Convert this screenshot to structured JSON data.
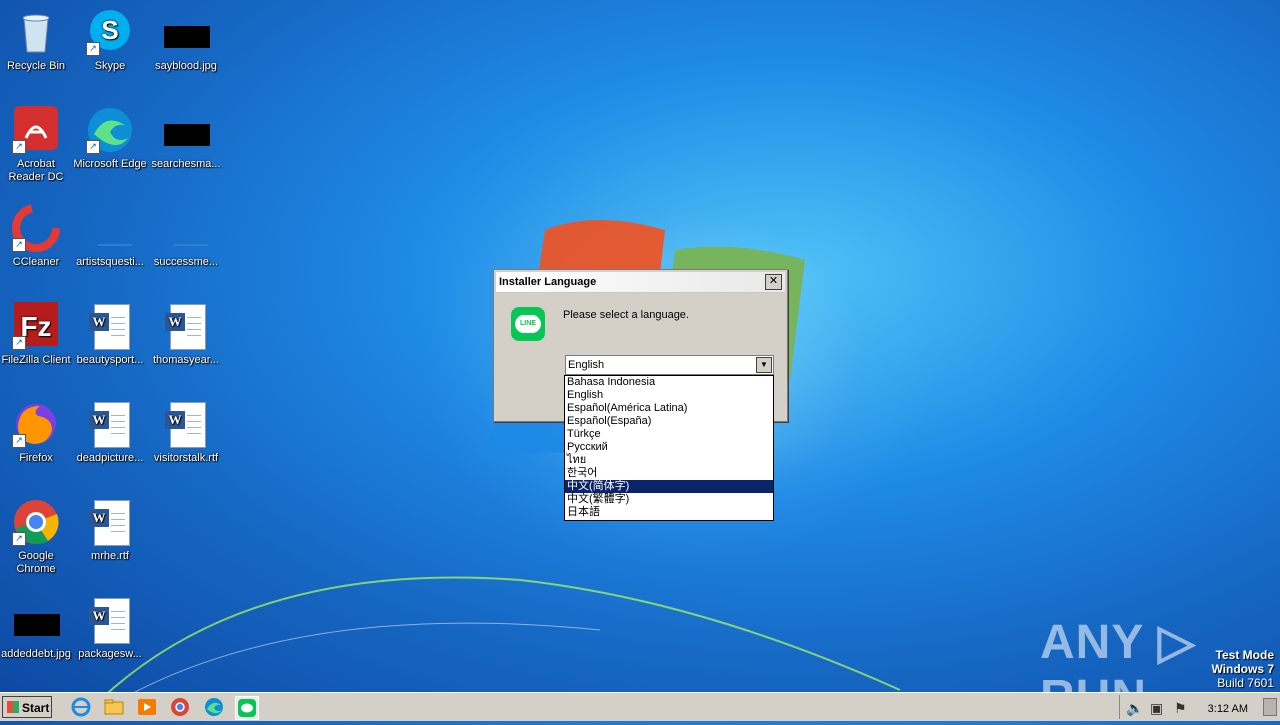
{
  "desktop": {
    "icons": [
      {
        "label": "Recycle Bin"
      },
      {
        "label": "Skype"
      },
      {
        "label": "sayblood.jpg"
      },
      {
        "label": "Acrobat Reader DC"
      },
      {
        "label": "Microsoft Edge"
      },
      {
        "label": "searchesma..."
      },
      {
        "label": "CCleaner"
      },
      {
        "label": "artistsquesti..."
      },
      {
        "label": "successme..."
      },
      {
        "label": "FileZilla Client"
      },
      {
        "label": "beautysport..."
      },
      {
        "label": "thomasyear..."
      },
      {
        "label": "Firefox"
      },
      {
        "label": "deadpicture..."
      },
      {
        "label": "visitorstalk.rtf"
      },
      {
        "label": "Google Chrome"
      },
      {
        "label": "mrhe.rtf"
      },
      {
        "label": "addeddebt.jpg"
      },
      {
        "label": "packagesw..."
      }
    ]
  },
  "dialog": {
    "title": "Installer Language",
    "close_label": "✕",
    "app_icon_text": "LINE",
    "prompt": "Please select a language.",
    "selected_value": "English",
    "options": [
      "Bahasa Indonesia",
      "English",
      "Español(América Latina)",
      "Español(España)",
      "Türkçe",
      "Русский",
      "ไทย",
      "한국어",
      "中文(简体字)",
      "中文(繁體字)",
      "日本語"
    ],
    "highlighted_option": "中文(简体字)"
  },
  "watermark": {
    "text": "ANY ▷ RUN",
    "test_mode": "Test Mode",
    "os": "Windows 7",
    "build": "Build 7601"
  },
  "taskbar": {
    "start_label": "Start",
    "clock": "3:12 AM"
  }
}
